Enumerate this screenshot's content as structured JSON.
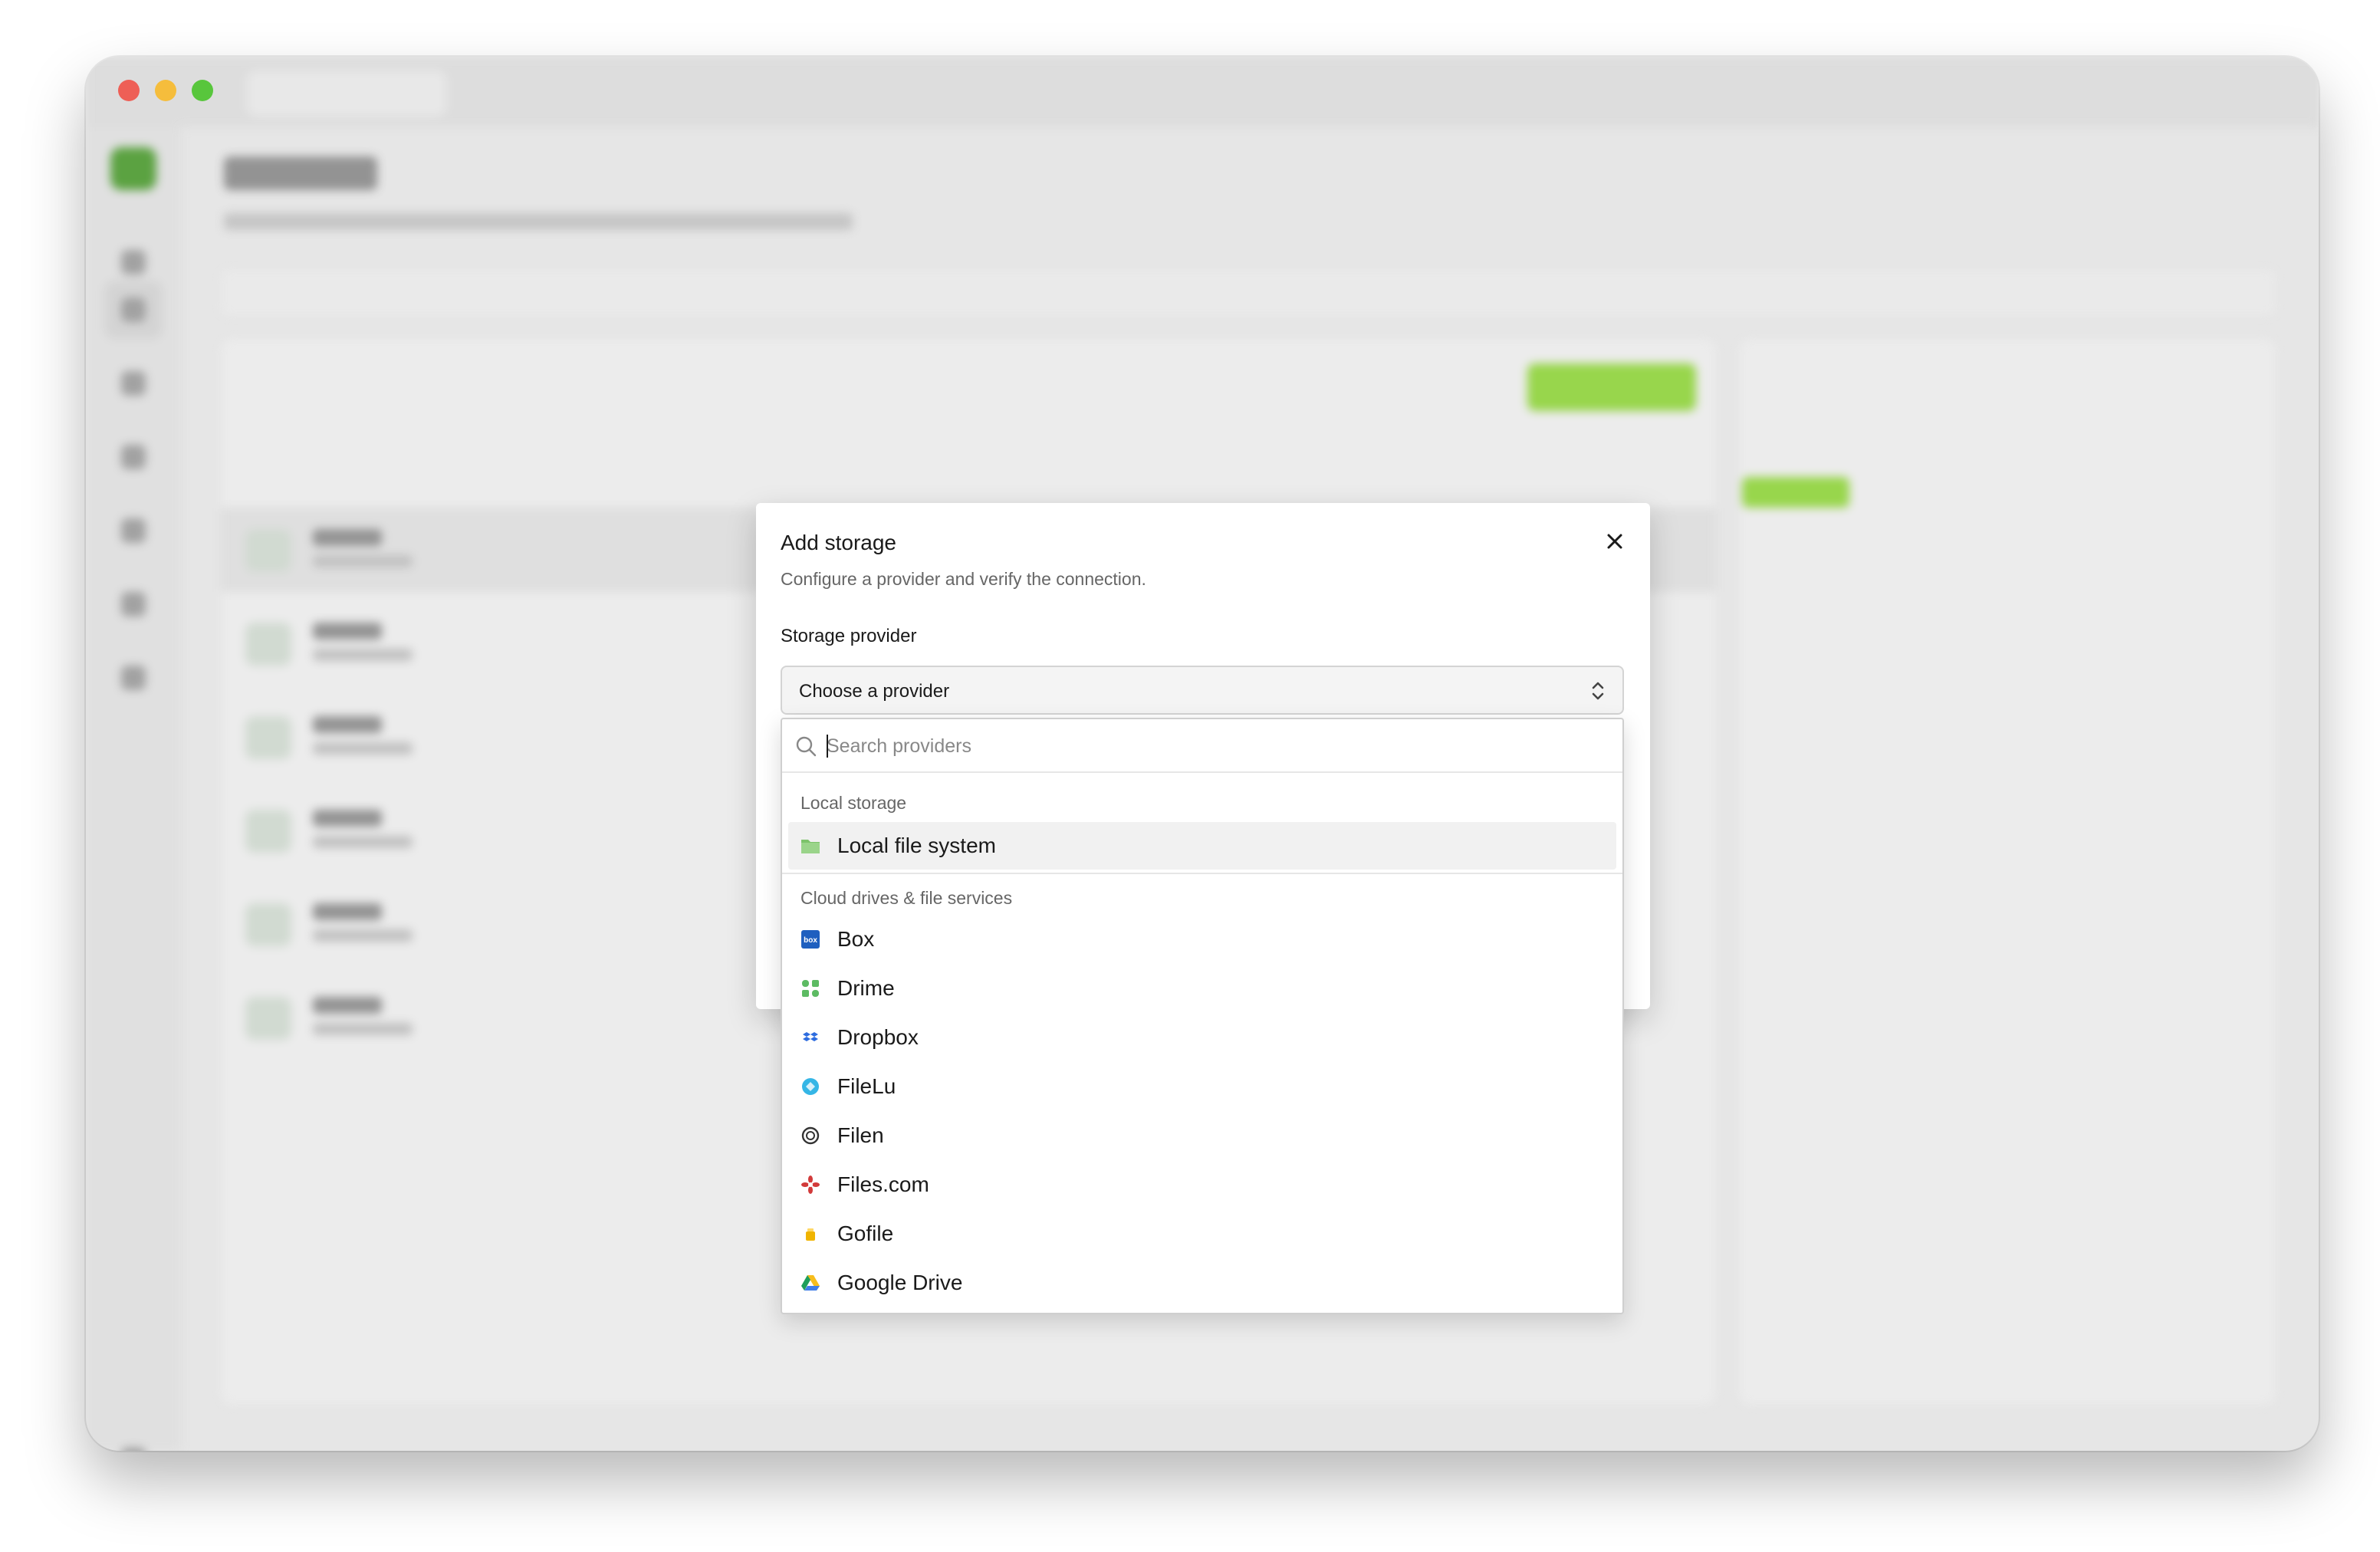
{
  "dialog": {
    "title": "Add storage",
    "subtitle": "Configure a provider and verify the connection.",
    "provider_label": "Storage provider",
    "select_value": "Choose a provider"
  },
  "dropdown": {
    "search_placeholder": "Search providers",
    "groups": [
      {
        "label": "Local storage",
        "items": [
          {
            "label": "Local file system",
            "icon": "folder-icon",
            "highlighted": true
          }
        ]
      },
      {
        "label": "Cloud drives & file services",
        "items": [
          {
            "label": "Box",
            "icon": "box-logo-icon"
          },
          {
            "label": "Drime",
            "icon": "drime-logo-icon"
          },
          {
            "label": "Dropbox",
            "icon": "dropbox-logo-icon"
          },
          {
            "label": "FileLu",
            "icon": "filelu-logo-icon"
          },
          {
            "label": "Filen",
            "icon": "filen-logo-icon"
          },
          {
            "label": "Files.com",
            "icon": "filescom-logo-icon"
          },
          {
            "label": "Gofile",
            "icon": "gofile-logo-icon"
          },
          {
            "label": "Google Drive",
            "icon": "google-drive-logo-icon"
          }
        ]
      }
    ]
  },
  "colors": {
    "window_bg": "#e6e6e6",
    "accent_green": "#8fd43a",
    "highlight": "#f1f1f1"
  }
}
